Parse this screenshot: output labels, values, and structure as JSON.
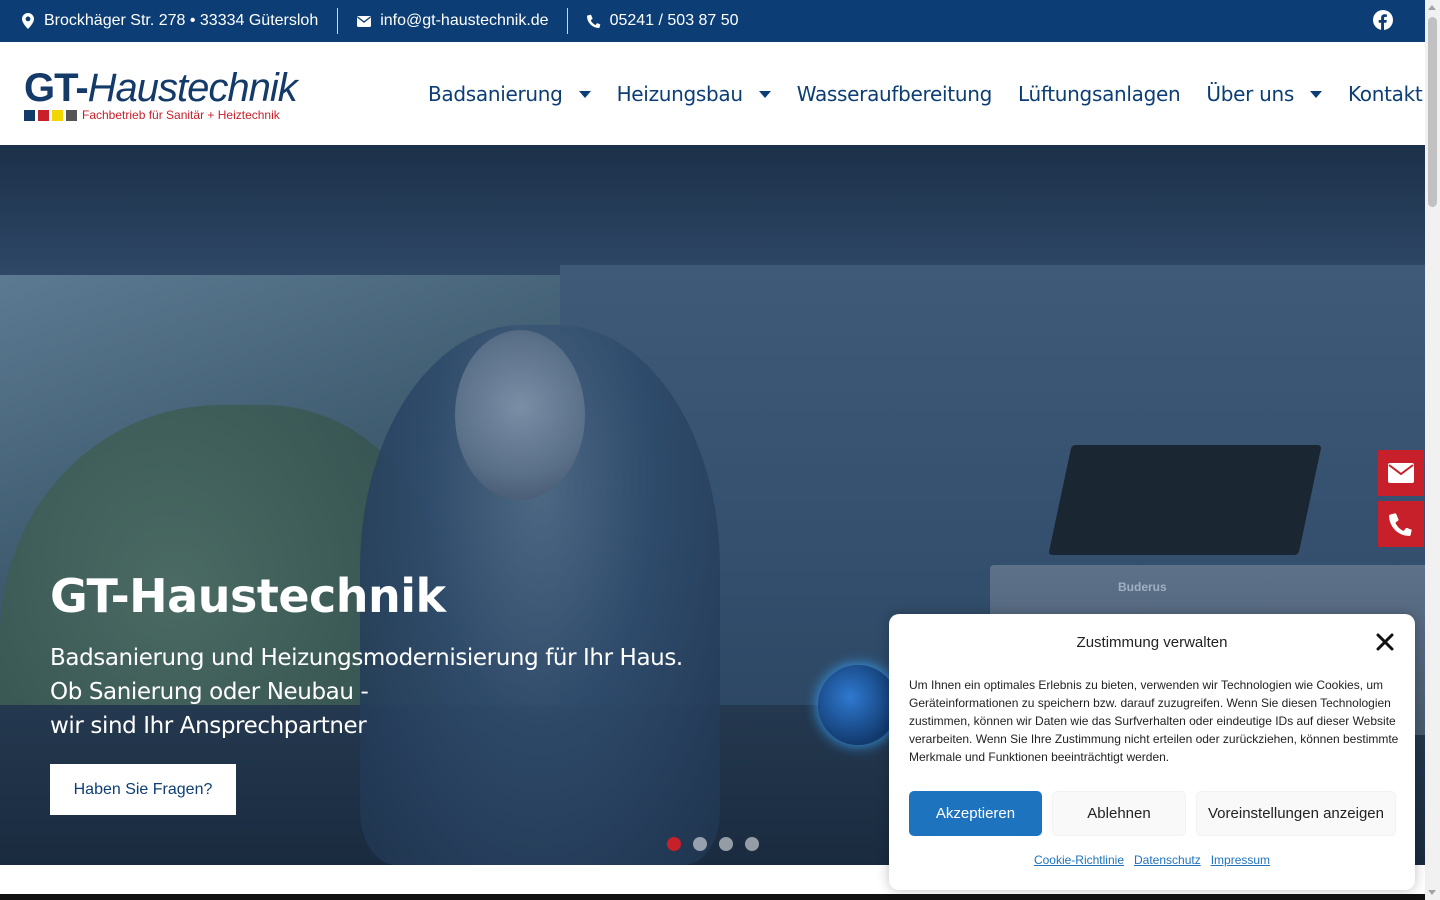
{
  "topbar": {
    "address": "Brockhäger Str. 278 • 33334 Gütersloh",
    "email": "info@gt-haustechnik.de",
    "phone": "05241 / 503 87 50",
    "icons": [
      "location-icon",
      "envelope-icon",
      "phone-icon",
      "facebook-icon"
    ]
  },
  "logo": {
    "main_bold": "GT-",
    "main_italic": "Haustechnik",
    "tagline": "Fachbetrieb für Sanitär + Heiztechnik",
    "square_colors": [
      "#143a6a",
      "#c8202a",
      "#f2d600",
      "#555555"
    ]
  },
  "nav": {
    "items": [
      {
        "label": "Badsanierung",
        "has_dropdown": true
      },
      {
        "label": "Heizungsbau",
        "has_dropdown": true
      },
      {
        "label": "Wasseraufbereitung",
        "has_dropdown": false
      },
      {
        "label": "Lüftungsanlagen",
        "has_dropdown": false
      },
      {
        "label": "Über uns",
        "has_dropdown": true
      },
      {
        "label": "Kontakt",
        "has_dropdown": true
      }
    ]
  },
  "hero": {
    "title": "GT-Haustechnik",
    "subtitle_lines": [
      "Badsanierung und Heizungsmodernisierung für Ihr Haus.",
      "Ob Sanierung oder Neubau -",
      "wir sind Ihr Ansprechpartner"
    ],
    "cta_label": "Haben Sie Fragen?",
    "device_brand": "Buderus",
    "slides_total": 4,
    "slide_active": 1
  },
  "cookie": {
    "title": "Zustimmung verwalten",
    "text": "Um Ihnen ein optimales Erlebnis zu bieten, verwenden wir Technologien wie Cookies, um Geräteinformationen zu speichern bzw. darauf zuzugreifen. Wenn Sie diesen Technologien zustimmen, können wir Daten wie das Surfverhalten oder eindeutige IDs auf dieser Website verarbeiten. Wenn Sie Ihre Zustimmung nicht erteilen oder zurückziehen, können bestimmte Merkmale und Funktionen beeinträchtigt werden.",
    "accept_label": "Akzeptieren",
    "deny_label": "Ablehnen",
    "prefs_label": "Voreinstellungen anzeigen",
    "links": [
      "Cookie-Richtlinie",
      "Datenschutz",
      "Impressum"
    ]
  },
  "colors": {
    "brand_blue": "#0c3e75",
    "accent_red": "#c8202a",
    "accept_blue": "#1e73be"
  }
}
